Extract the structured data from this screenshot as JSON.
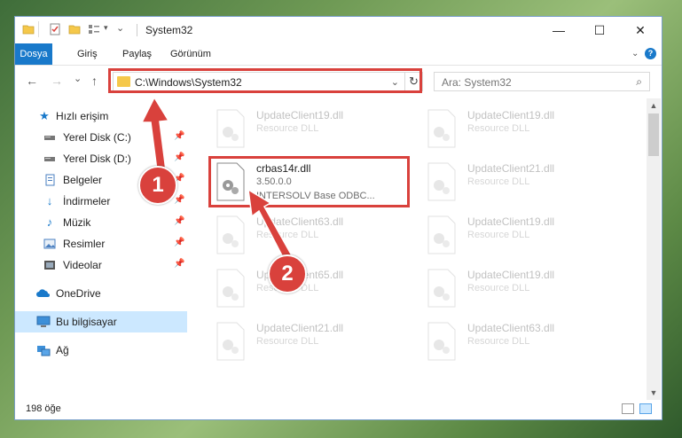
{
  "window": {
    "title": "System32",
    "controls": {
      "minimize": "—",
      "maximize": "☐",
      "close": "✕"
    }
  },
  "ribbon": {
    "tabs": [
      "Dosya",
      "Giriş",
      "Paylaş",
      "Görünüm"
    ],
    "expand_icon": "chevron-down-icon",
    "help_icon": "help-icon"
  },
  "navigation": {
    "back": "←",
    "forward": "→",
    "recent": "⌄",
    "up": "↑",
    "address": "C:\\Windows\\System32",
    "address_dropdown": "⌄",
    "refresh": "↻",
    "search_placeholder": "Ara: System32",
    "search_icon": "⌕"
  },
  "sidebar": {
    "items": [
      {
        "label": "Hızlı erişim",
        "icon": "star-icon",
        "pinned": false
      },
      {
        "label": "Yerel Disk (C:)",
        "icon": "drive-icon",
        "pinned": true
      },
      {
        "label": "Yerel Disk (D:)",
        "icon": "drive-icon",
        "pinned": true
      },
      {
        "label": "Belgeler",
        "icon": "documents-icon",
        "pinned": true
      },
      {
        "label": "İndirmeler",
        "icon": "download-icon",
        "pinned": true
      },
      {
        "label": "Müzik",
        "icon": "music-icon",
        "pinned": true
      },
      {
        "label": "Resimler",
        "icon": "pictures-icon",
        "pinned": true
      },
      {
        "label": "Videolar",
        "icon": "videos-icon",
        "pinned": true
      },
      {
        "label": "OneDrive",
        "icon": "cloud-icon",
        "pinned": false
      },
      {
        "label": "Bu bilgisayar",
        "icon": "computer-icon",
        "pinned": false,
        "selected": true
      },
      {
        "label": "Ağ",
        "icon": "network-icon",
        "pinned": false
      }
    ]
  },
  "files": {
    "left": [
      {
        "name": "UpdateClient19.dll",
        "desc": "Resource DLL"
      },
      {
        "name": "UpdateClient63.dll",
        "desc": "Resource DLL"
      },
      {
        "name": "UpdateClient65.dll",
        "desc": "Resource DLL"
      },
      {
        "name": "UpdateClient21.dll",
        "desc": "Resource DLL"
      }
    ],
    "right": [
      {
        "name": "UpdateClient19.dll",
        "desc": "Resource DLL"
      },
      {
        "name": "UpdateClient21.dll",
        "desc": "Resource DLL"
      },
      {
        "name": "UpdateClient19.dll",
        "desc": "Resource DLL"
      },
      {
        "name": "UpdateClient19.dll",
        "desc": "Resource DLL"
      },
      {
        "name": "UpdateClient63.dll",
        "desc": "Resource DLL"
      }
    ],
    "highlighted": {
      "name": "crbas14r.dll",
      "version": "3.50.0.0",
      "desc": "INTERSOLV Base ODBC..."
    }
  },
  "status": {
    "item_count": "198 öğe"
  },
  "annotations": {
    "callout_1": "1",
    "callout_2": "2",
    "accent": "#d9413c"
  }
}
